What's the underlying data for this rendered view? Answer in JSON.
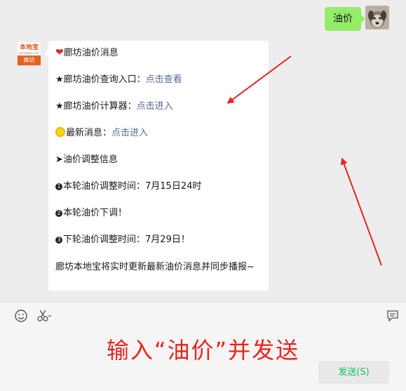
{
  "chat": {
    "outgoing": {
      "text": "油价"
    },
    "bot": {
      "avatar_brand": "本地宝",
      "avatar_sub": "bendibao.com",
      "avatar_city": "廊坊"
    },
    "incoming": {
      "title": "廊坊油价消息",
      "query_label": "★廊坊油价查询入口：",
      "query_link": "点击查看",
      "calc_label": "★廊坊油价计算器：",
      "calc_link": "点击进入",
      "news_label": "最新消息：",
      "news_link": "点击进入",
      "adjust_header": "➤油价调整信息",
      "item1_num": "1",
      "item1": "本轮油价调整时间：7月15日24时",
      "item2_num": "2",
      "item2": "本轮油价下调！",
      "item3_num": "3",
      "item3": "下轮油价调整时间：7月29日！",
      "footer": "廊坊本地宝将实时更新最新油价消息并同步播报~"
    }
  },
  "input": {
    "emoji_icon": "smiley-icon",
    "scissors_icon": "scissors-icon",
    "bubble_icon": "chat-bubble-icon"
  },
  "annotation": {
    "text": "输入“油价”并发送",
    "color": "#e8251f"
  },
  "send_button": {
    "label": "发送(S)"
  },
  "colors": {
    "bubble_out": "#95ec69",
    "link": "#576b95",
    "send_text": "#07c160"
  }
}
